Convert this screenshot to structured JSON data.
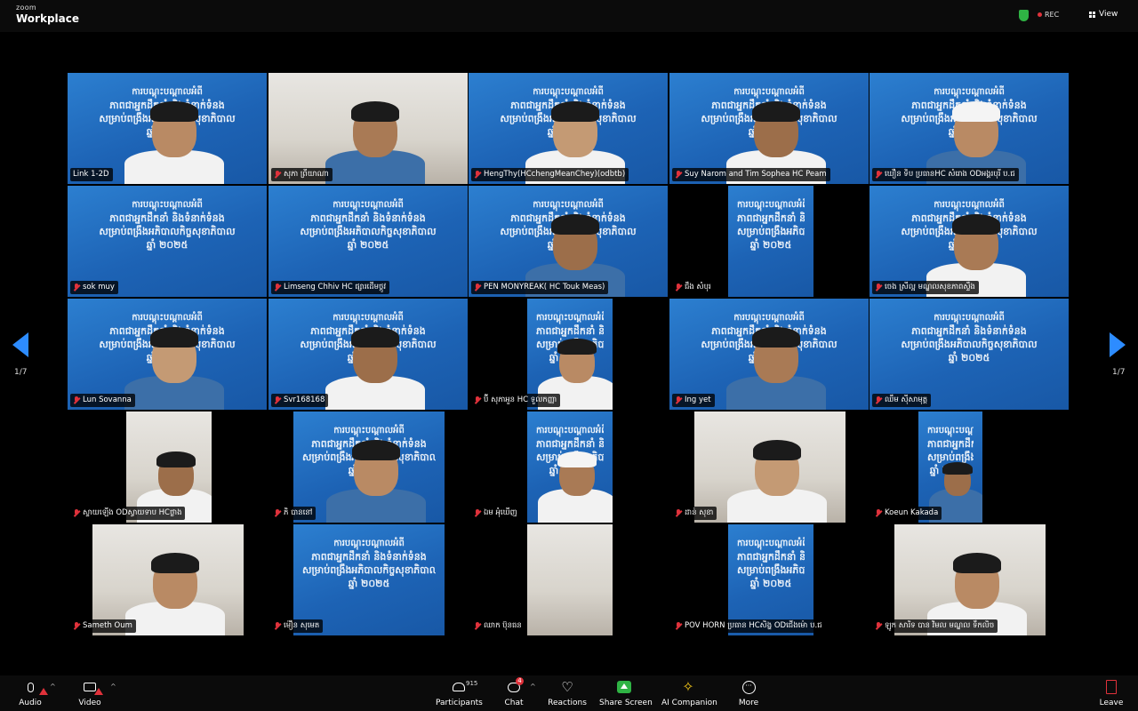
{
  "window": {
    "brand_small": "zoom",
    "brand_big": "Workplace",
    "rec_label": "REC",
    "view_label": "View"
  },
  "pagination": {
    "left": "1/7",
    "right": "1/7"
  },
  "slide_text": {
    "line1": "ការបណ្តុះបណ្តាលអំពី",
    "line2": "ភាពជាអ្នកដឹកនាំ និងទំនាក់ទំនង",
    "line3": "សម្រាប់ពង្រឹងអភិបាលកិច្ចសុខាភិបាល",
    "line4": "ឆ្នាំ ២០២៥"
  },
  "tiles": [
    {
      "name": "Link 1-2D",
      "bg": "slide",
      "person": true
    },
    {
      "name": "សុភា ព្រីយាណា",
      "bg": "room",
      "person": true
    },
    {
      "name": "HengThy(HCchengMeanChey)(odbtb)",
      "bg": "slide",
      "person": true
    },
    {
      "name": "Suy Narom and Tim Sophea HC Peam",
      "bg": "slide",
      "person": true
    },
    {
      "name": "ឃឿន ទិប ប្រធានHC សំរោង ODអង្គរបុរី ប.ជ",
      "bg": "slide",
      "person": true
    },
    {
      "name": "sok muy",
      "bg": "slide",
      "person": false
    },
    {
      "name": "Limseng Chhiv HC ផ្សារដើមថ្កូវ",
      "bg": "slide",
      "person": false
    },
    {
      "name": "PEN MONYREAK( HC Touk Meas)",
      "bg": "slide",
      "person": true
    },
    {
      "name": "ជឹង សំបុរ",
      "bg": "slide",
      "person": false
    },
    {
      "name": "ចេង ស្រីល្អ មណ្ឌលសុខភាពស្ទឹង",
      "bg": "slide",
      "person": true
    },
    {
      "name": "Lun Sovanna",
      "bg": "slide",
      "person": true
    },
    {
      "name": "Svr168168",
      "bg": "slide",
      "person": true
    },
    {
      "name": "ប៊ី សុភាអួន HC ទួលកញ្ញា",
      "bg": "slide",
      "person": true
    },
    {
      "name": "Ing yet",
      "bg": "slide",
      "person": true
    },
    {
      "name": "ឈឹម ស៊ីសាមុត្ត",
      "bg": "slide",
      "person": false
    },
    {
      "name": "ស្ទាយឡើង ODស្វាយទាប HCថ្លាង",
      "bg": "room",
      "person": true
    },
    {
      "name": "ភិ បាននៅ",
      "bg": "slide",
      "person": true
    },
    {
      "name": "ឯម អុំឃើញ",
      "bg": "slide",
      "person": true
    },
    {
      "name": "ដាន់ សុខា",
      "bg": "room",
      "person": true
    },
    {
      "name": "Koeun Kakada",
      "bg": "slide",
      "person": true
    },
    {
      "name": "Sameth Oum",
      "bg": "room",
      "person": true
    },
    {
      "name": "ម៉ឿន សុមេត",
      "bg": "slide",
      "person": false
    },
    {
      "name": "ឈាក ប៊ុនធន",
      "bg": "room",
      "person": false
    },
    {
      "name": "POV HORN ប្រធាន HCសិង្ហ ODជើងម៉ោ ប.ជ",
      "bg": "slide",
      "person": false
    },
    {
      "name": "ឡូក សារិទ បាន វិមល មណ្ឌល ទឹកលិច",
      "bg": "room",
      "person": true
    }
  ],
  "toolbar": {
    "audio": "Audio",
    "video": "Video",
    "participants": "Participants",
    "participants_count": "915",
    "chat": "Chat",
    "chat_badge": "4",
    "reactions": "Reactions",
    "share_screen": "Share Screen",
    "ai_companion": "AI Companion",
    "more": "More",
    "leave": "Leave"
  }
}
